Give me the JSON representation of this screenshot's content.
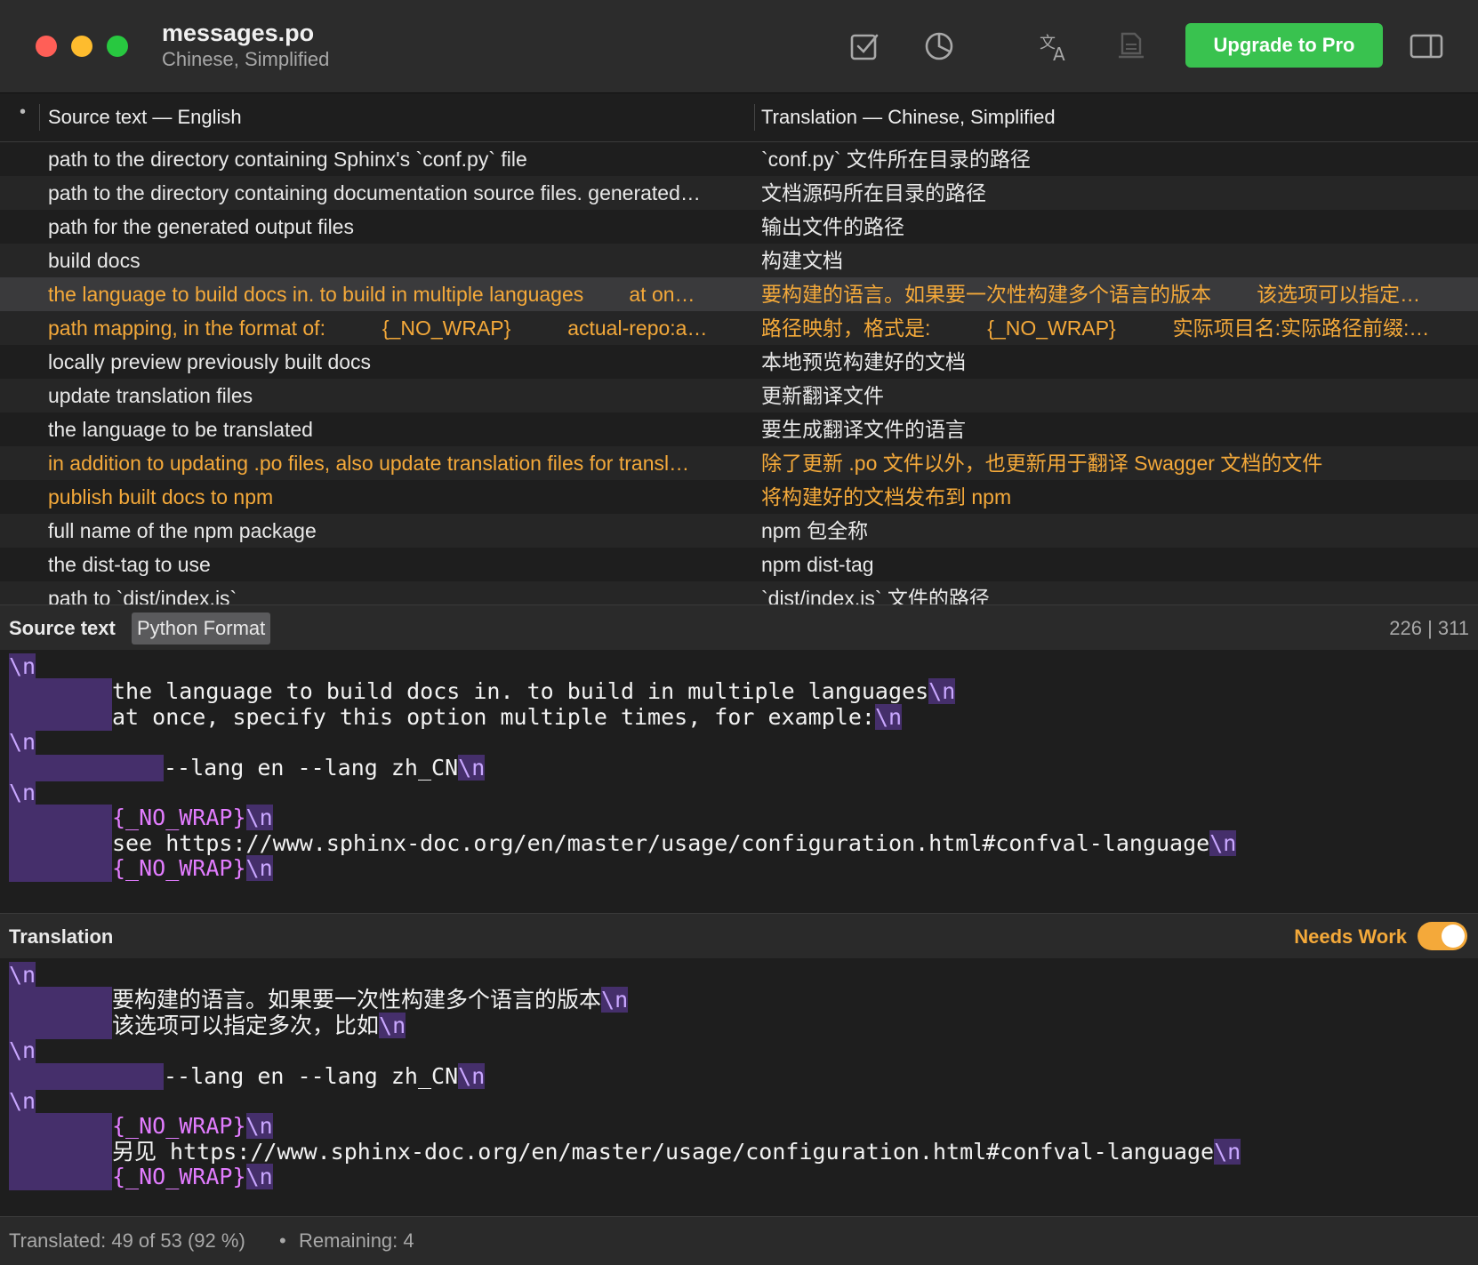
{
  "window": {
    "title": "messages.po",
    "subtitle": "Chinese, Simplified",
    "upgrade_label": "Upgrade to Pro",
    "icons": [
      "checkmark-square-icon",
      "pie-chart-icon",
      "translate-icon",
      "document-icon",
      "sidebar-toggle-icon"
    ]
  },
  "columns": {
    "marker": "•",
    "source": "Source text — English",
    "translation": "Translation — Chinese, Simplified"
  },
  "rows": [
    {
      "src": "path to the directory containing Sphinx's `conf.py` file",
      "tr": "`conf.py` 文件所在目录的路径",
      "state": "normal"
    },
    {
      "src": "path to the directory containing documentation source files. generated…",
      "tr": "文档源码所在目录的路径",
      "state": "normal"
    },
    {
      "src": "path for the generated output files",
      "tr": "输出文件的路径",
      "state": "normal"
    },
    {
      "src": "build docs",
      "tr": "构建文档",
      "state": "normal"
    },
    {
      "src": "the language to build docs in. to build in multiple languages        at on…",
      "tr": "要构建的语言。如果要一次性构建多个语言的版本        该选项可以指定…",
      "state": "warn-selected"
    },
    {
      "src": "path mapping, in the format of:          {_NO_WRAP}          actual-repo:a…",
      "tr": "路径映射，格式是:          {_NO_WRAP}          实际项目名:实际路径前缀:…",
      "state": "warn"
    },
    {
      "src": "locally preview previously built docs",
      "tr": "本地预览构建好的文档",
      "state": "normal"
    },
    {
      "src": "update translation files",
      "tr": "更新翻译文件",
      "state": "normal"
    },
    {
      "src": "the language to be translated",
      "tr": "要生成翻译文件的语言",
      "state": "normal"
    },
    {
      "src": "in addition to updating .po files, also update translation files for transl…",
      "tr": "除了更新 .po 文件以外，也更新用于翻译 Swagger 文档的文件",
      "state": "warn"
    },
    {
      "src": "publish built docs to npm",
      "tr": "将构建好的文档发布到 npm",
      "state": "warn"
    },
    {
      "src": "full name of the npm package",
      "tr": "npm 包全称",
      "state": "normal"
    },
    {
      "src": "the dist-tag to use",
      "tr": "npm dist-tag",
      "state": "normal"
    },
    {
      "src": "path to `dist/index.js`",
      "tr": "`dist/index.js` 文件的路径",
      "state": "normal"
    }
  ],
  "source_panel": {
    "title": "Source text",
    "format": "Python Format",
    "counter": "226 | 311",
    "lines": [
      {
        "indent": 0,
        "text": "",
        "nl": "\\n",
        "kind": "plain"
      },
      {
        "indent": 4,
        "text": "the language to build docs in. to build in multiple languages",
        "nl": "\\n",
        "kind": "plain"
      },
      {
        "indent": 4,
        "text": "at once, specify this option multiple times, for example:",
        "nl": "\\n",
        "kind": "plain"
      },
      {
        "indent": 0,
        "text": "",
        "nl": "\\n",
        "kind": "plain"
      },
      {
        "indent": 6,
        "text": "--lang en --lang zh_CN",
        "nl": "\\n",
        "kind": "plain"
      },
      {
        "indent": 0,
        "text": "",
        "nl": "\\n",
        "kind": "plain"
      },
      {
        "indent": 4,
        "text": "{_NO_WRAP}",
        "nl": "\\n",
        "kind": "tag"
      },
      {
        "indent": 4,
        "text": "see https://www.sphinx-doc.org/en/master/usage/configuration.html#confval-language",
        "nl": "\\n",
        "kind": "plain"
      },
      {
        "indent": 4,
        "text": "{_NO_WRAP}",
        "nl": "\\n",
        "kind": "tag"
      }
    ]
  },
  "translation_panel": {
    "title": "Translation",
    "needs_work_label": "Needs Work",
    "needs_work": true,
    "lines": [
      {
        "indent": 0,
        "text": "",
        "nl": "\\n",
        "kind": "plain"
      },
      {
        "indent": 4,
        "text": "要构建的语言。如果要一次性构建多个语言的版本",
        "nl": "\\n",
        "kind": "plain"
      },
      {
        "indent": 4,
        "text": "该选项可以指定多次，比如",
        "nl": "\\n",
        "kind": "plain"
      },
      {
        "indent": 0,
        "text": "",
        "nl": "\\n",
        "kind": "plain"
      },
      {
        "indent": 6,
        "text": "--lang en --lang zh_CN",
        "nl": "\\n",
        "kind": "plain"
      },
      {
        "indent": 0,
        "text": "",
        "nl": "\\n",
        "kind": "plain"
      },
      {
        "indent": 4,
        "text": "{_NO_WRAP}",
        "nl": "\\n",
        "kind": "tag"
      },
      {
        "indent": 4,
        "text": "另见 https://www.sphinx-doc.org/en/master/usage/configuration.html#confval-language",
        "nl": "\\n",
        "kind": "plain"
      },
      {
        "indent": 4,
        "text": "{_NO_WRAP}",
        "nl": "\\n",
        "kind": "tag"
      }
    ]
  },
  "status": {
    "translated": "Translated: 49 of 53 (92 %)",
    "separator": "•",
    "remaining": "Remaining: 4"
  },
  "colors": {
    "accent_green": "#39c24f",
    "warning_orange": "#f4a93a",
    "whitespace_purple": "#452f6b",
    "tag_pink": "#e27cff"
  }
}
